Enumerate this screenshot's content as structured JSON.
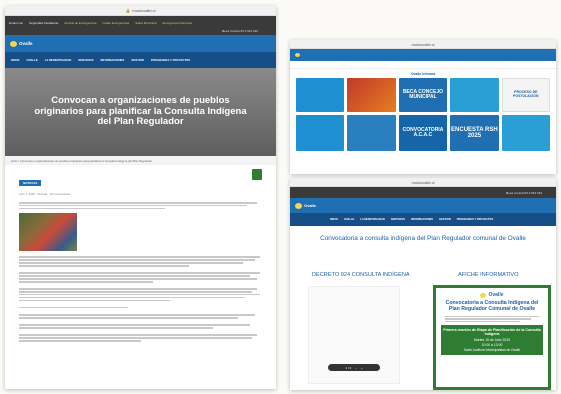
{
  "main": {
    "url": "municoalle.cl",
    "topbar": [
      "Email mun",
      "Seguridad Ciudadana",
      "Central de Emergencias",
      "Ovalle Emergencias",
      "Salud Municipal",
      "Emergencia Municipal"
    ],
    "topbar_right": "Mesa Central 53 2 661 010",
    "logo": "Ovalle",
    "nav": [
      "INICIO",
      "OVALLE",
      "LA MUNICIPALIDAD",
      "SERVICIOS",
      "INFORMACIONES",
      "GESTION",
      "PROGRAMAS Y PROYECTOS"
    ],
    "hero_title": "Convocan a organizaciones de pueblos originarios para planificar la Consulta Indígena del Plan Regulador",
    "breadcrumb": "Inicio / Convocan a organizaciones de pueblos originarios para planificar la Consulta Indígena del Plan Regulador",
    "badge": "NOTICIAS",
    "meta": "Julio 7, 2025 · Noticias · Sin Comentarios"
  },
  "top_right": {
    "url": "municoalle.cl",
    "heading": "Ovalle Informa",
    "tiles": [
      {
        "label": "",
        "color": "#1e8fd0"
      },
      {
        "label": "",
        "color": "#c0392b"
      },
      {
        "label": "BECA CONCEJO MUNICIPAL",
        "color": "#1f6fb2"
      },
      {
        "label": "",
        "color": "#2a9fd6"
      },
      {
        "label": "PROCESO DE POSTULACIÓN",
        "color": "#f4f4f4"
      },
      {
        "label": "",
        "color": "#1e8fd0"
      },
      {
        "label": "",
        "color": "#2a7fbf"
      },
      {
        "label": "CONVOCATORIA A.C.A.C",
        "color": "#1565a8"
      },
      {
        "label": "ENCUESTA RSH 2025",
        "color": "#1f6fb2"
      },
      {
        "label": "",
        "color": "#2a9fd6"
      }
    ]
  },
  "bottom_right": {
    "url": "municoalle.cl",
    "topbar_right": "Mesa Central 53 2 661 010",
    "logo": "Ovalle",
    "nav": [
      "INICIO",
      "OVALLE",
      "LA MUNICIPALIDAD",
      "SERVICIOS",
      "INFORMACIONES",
      "GESTION",
      "PROGRAMAS Y PROYECTOS"
    ],
    "title": "Convocatoria a consulta indígena del Plan Regulador comunal de Ovalle",
    "left_heading": "DECRETO 924 CONSULTA INDÍGENA",
    "right_heading": "AFICHE INFORMATIVO",
    "poster_logo": "Ovalle",
    "poster_title": "Convocatoria a Consulta Indígena del Plan Regulador Comunal de Ovalle",
    "poster_box": "Primera reunión de Etapa de Planificación de la Consulta Indígena",
    "poster_date": "Martes 15 de Julio 2025",
    "poster_time": "10:00 a 13:00",
    "poster_place": "Salón Auditorio Municipalidad de Ovalle",
    "pdf_page": "1 / 3"
  },
  "colors": {
    "brand": "#1f6fb2",
    "nav": "#164f87",
    "topbar": "#3a3a3a",
    "poster_green": "#2e7d32",
    "title_blue": "#1f5fa8"
  }
}
